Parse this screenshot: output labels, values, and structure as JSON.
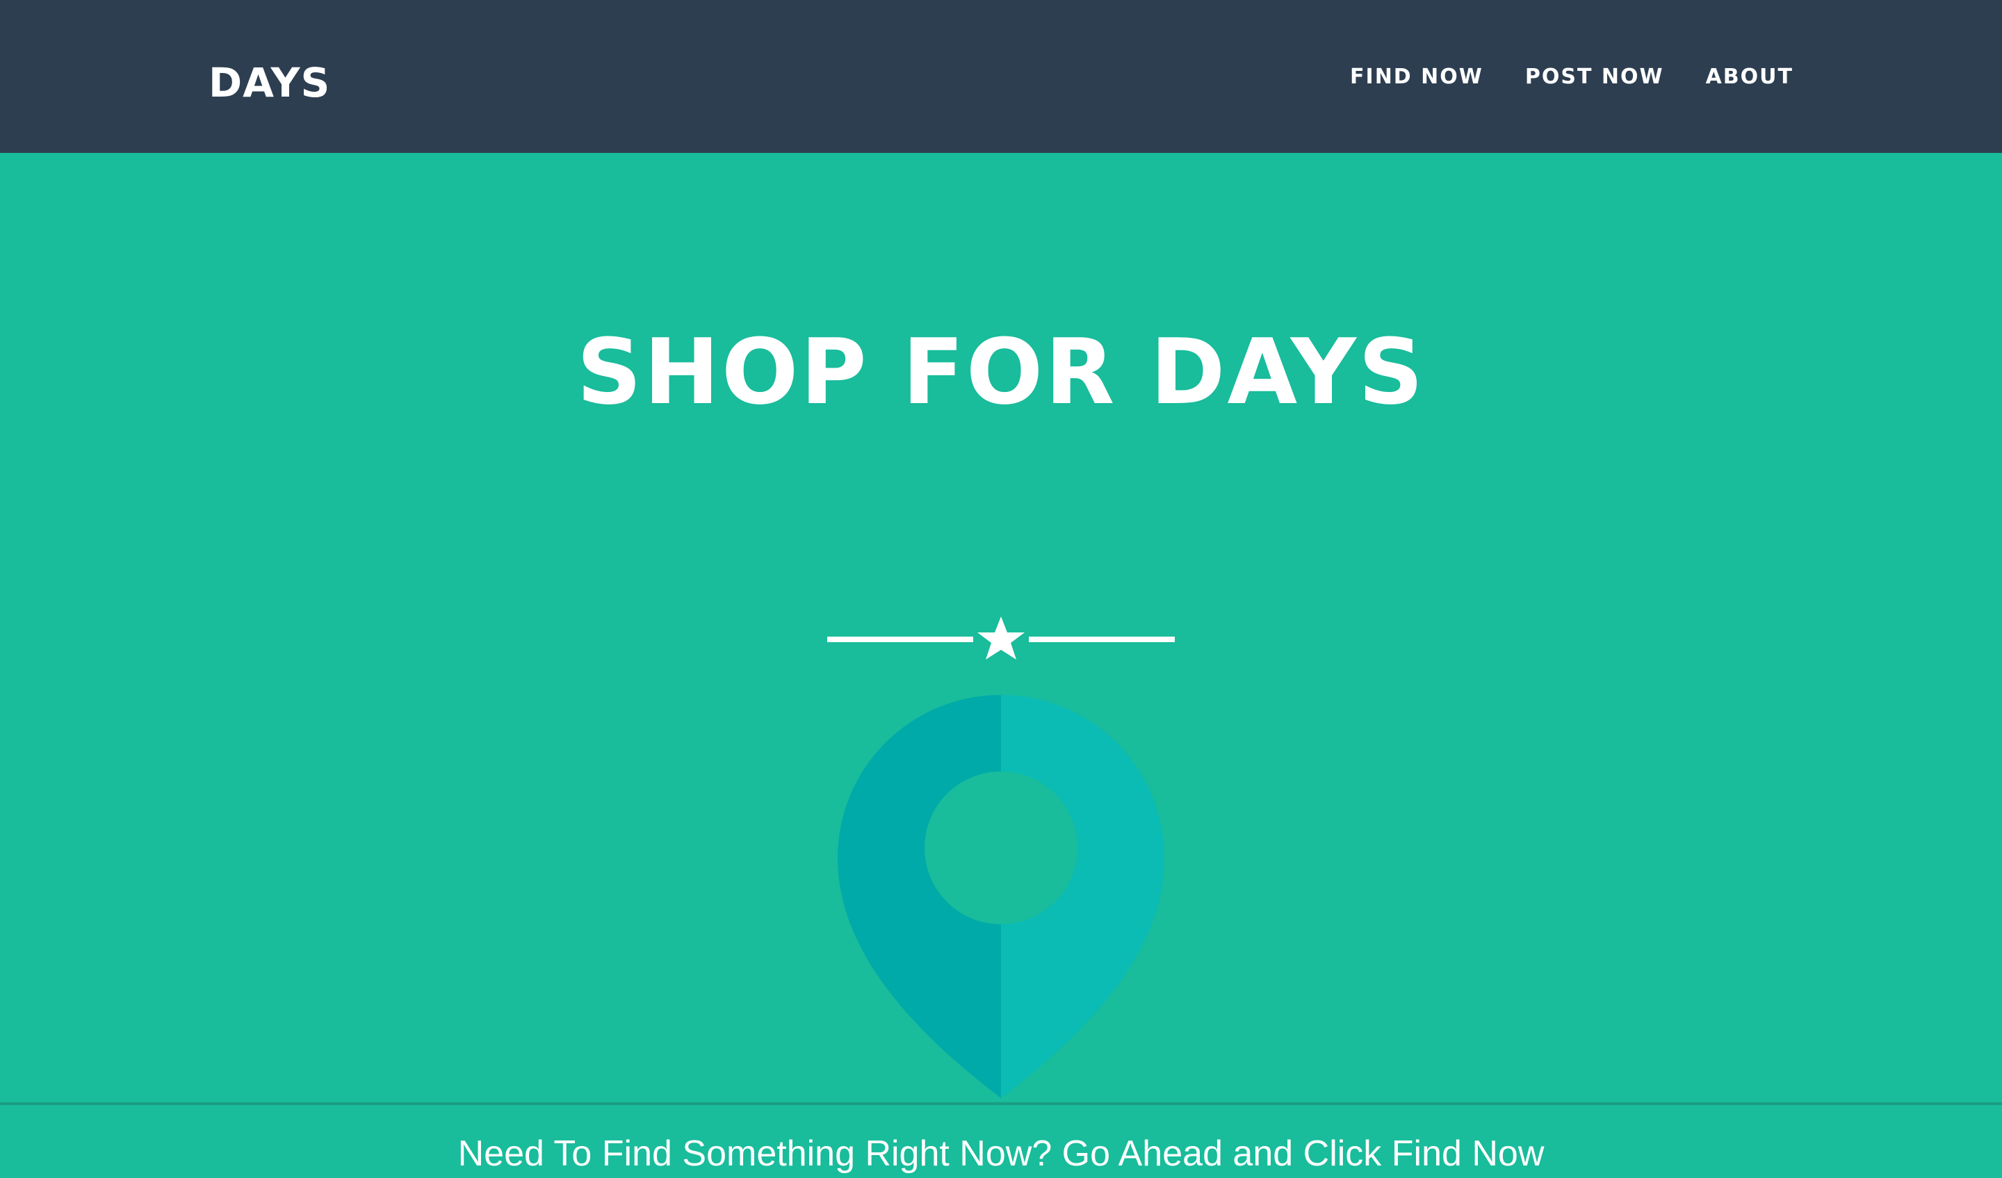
{
  "navbar": {
    "brand": "DAYS",
    "links": [
      {
        "label": "FIND NOW"
      },
      {
        "label": "POST NOW"
      },
      {
        "label": "ABOUT"
      }
    ]
  },
  "hero": {
    "title": "SHOP FOR DAYS",
    "subtitle": "Need To Find Something Right Now? Go Ahead and Click Find Now",
    "icons": {
      "divider": "star-icon",
      "graphic": "map-pin-icon"
    }
  },
  "colors": {
    "navbar_bg": "#2d3e51",
    "hero_bg": "#19bc9b",
    "pin_dark": "#00aaa9",
    "pin_light": "#0bbcb5",
    "text": "#ffffff"
  }
}
